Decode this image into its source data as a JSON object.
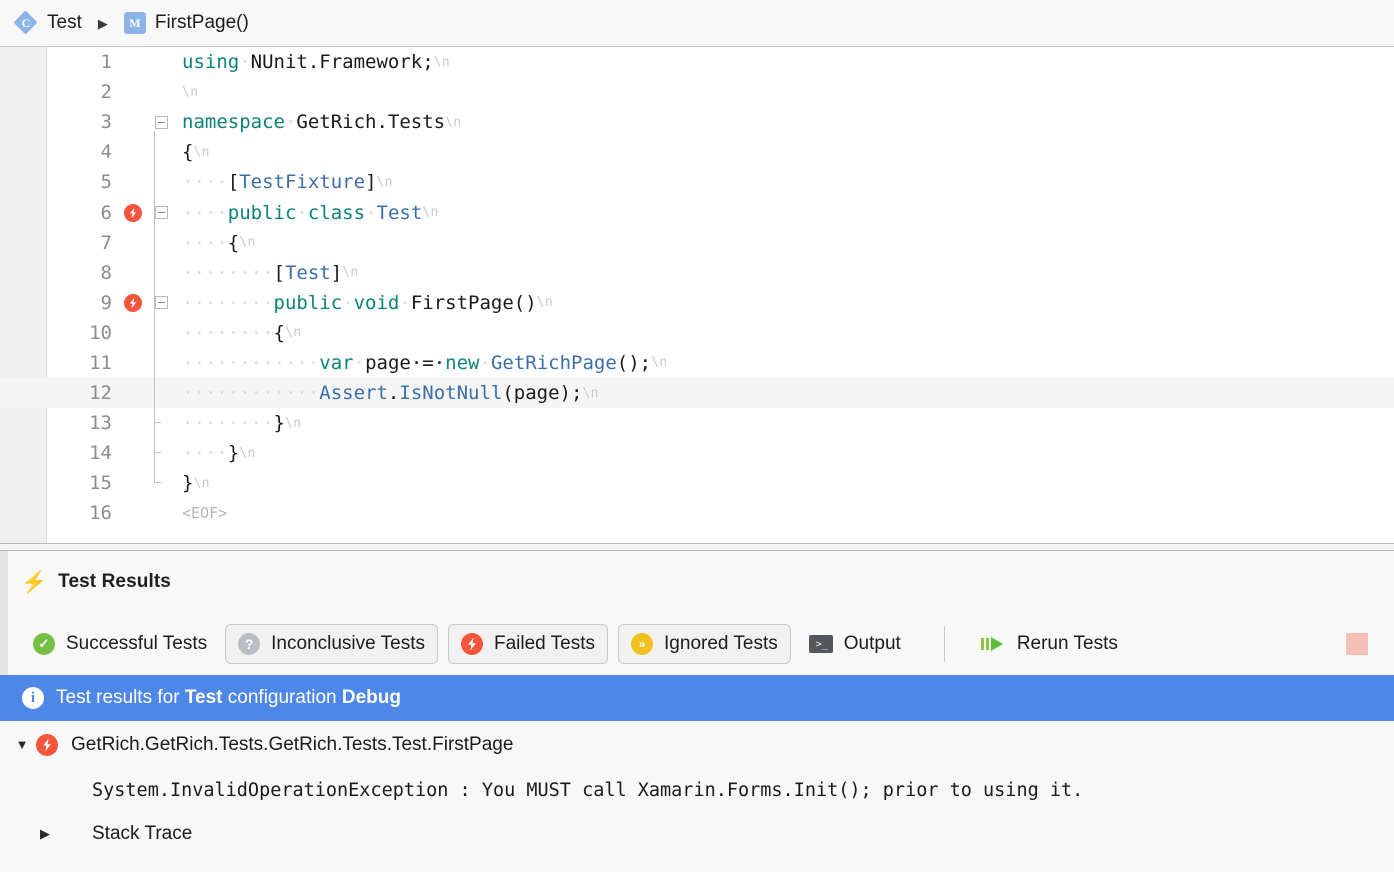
{
  "breadcrumb": {
    "class_icon": "class-icon",
    "class_name": "Test",
    "separator": "▶",
    "method_icon": "method-icon",
    "method_name": "FirstPage()"
  },
  "editor": {
    "eof_marker": "<EOF>",
    "newline_marker": "\\n",
    "lines": [
      {
        "num": "1",
        "fail": false,
        "fold": "none",
        "current": false,
        "tokens": [
          {
            "t": "using",
            "c": "kw"
          },
          {
            "t": "·",
            "c": "ws"
          },
          {
            "t": "NUnit.Framework;",
            "c": "pln"
          },
          {
            "t": "\\n",
            "c": "nl"
          }
        ]
      },
      {
        "num": "2",
        "fail": false,
        "fold": "none",
        "current": false,
        "tokens": [
          {
            "t": "\\n",
            "c": "nl"
          }
        ]
      },
      {
        "num": "3",
        "fail": false,
        "fold": "start",
        "current": false,
        "tokens": [
          {
            "t": "namespace",
            "c": "kw"
          },
          {
            "t": "·",
            "c": "ws"
          },
          {
            "t": "GetRich.Tests",
            "c": "pln"
          },
          {
            "t": "\\n",
            "c": "nl"
          }
        ]
      },
      {
        "num": "4",
        "fail": false,
        "fold": "body",
        "current": false,
        "tokens": [
          {
            "t": "{",
            "c": "pln"
          },
          {
            "t": "\\n",
            "c": "nl"
          }
        ]
      },
      {
        "num": "5",
        "fail": false,
        "fold": "body",
        "current": false,
        "tokens": [
          {
            "t": "····",
            "c": "ws"
          },
          {
            "t": "[",
            "c": "pln"
          },
          {
            "t": "TestFixture",
            "c": "typ"
          },
          {
            "t": "]",
            "c": "pln"
          },
          {
            "t": "\\n",
            "c": "nl"
          }
        ]
      },
      {
        "num": "6",
        "fail": true,
        "fold": "start",
        "current": false,
        "tokens": [
          {
            "t": "····",
            "c": "ws"
          },
          {
            "t": "public",
            "c": "kw"
          },
          {
            "t": "·",
            "c": "ws"
          },
          {
            "t": "class",
            "c": "kw"
          },
          {
            "t": "·",
            "c": "ws"
          },
          {
            "t": "Test",
            "c": "typ"
          },
          {
            "t": "\\n",
            "c": "nl"
          }
        ]
      },
      {
        "num": "7",
        "fail": false,
        "fold": "body",
        "current": false,
        "tokens": [
          {
            "t": "····",
            "c": "ws"
          },
          {
            "t": "{",
            "c": "pln"
          },
          {
            "t": "\\n",
            "c": "nl"
          }
        ]
      },
      {
        "num": "8",
        "fail": false,
        "fold": "body",
        "current": false,
        "tokens": [
          {
            "t": "········",
            "c": "ws"
          },
          {
            "t": "[",
            "c": "pln"
          },
          {
            "t": "Test",
            "c": "typ"
          },
          {
            "t": "]",
            "c": "pln"
          },
          {
            "t": "\\n",
            "c": "nl"
          }
        ]
      },
      {
        "num": "9",
        "fail": true,
        "fold": "start",
        "current": false,
        "tokens": [
          {
            "t": "········",
            "c": "ws"
          },
          {
            "t": "public",
            "c": "kw"
          },
          {
            "t": "·",
            "c": "ws"
          },
          {
            "t": "void",
            "c": "kw"
          },
          {
            "t": "·",
            "c": "ws"
          },
          {
            "t": "FirstPage()",
            "c": "pln"
          },
          {
            "t": "\\n",
            "c": "nl"
          }
        ]
      },
      {
        "num": "10",
        "fail": false,
        "fold": "body",
        "current": false,
        "tokens": [
          {
            "t": "········",
            "c": "ws"
          },
          {
            "t": "{",
            "c": "pln"
          },
          {
            "t": "\\n",
            "c": "nl"
          }
        ]
      },
      {
        "num": "11",
        "fail": false,
        "fold": "body",
        "current": false,
        "tokens": [
          {
            "t": "············",
            "c": "ws"
          },
          {
            "t": "var",
            "c": "kw"
          },
          {
            "t": "·",
            "c": "ws"
          },
          {
            "t": "page",
            "c": "pln"
          },
          {
            "t": "·=·",
            "c": "pln"
          },
          {
            "t": "new",
            "c": "kw"
          },
          {
            "t": "·",
            "c": "ws"
          },
          {
            "t": "GetRichPage",
            "c": "typ"
          },
          {
            "t": "();",
            "c": "pln"
          },
          {
            "t": "\\n",
            "c": "nl"
          }
        ]
      },
      {
        "num": "12",
        "fail": false,
        "fold": "body",
        "current": true,
        "tokens": [
          {
            "t": "············",
            "c": "ws"
          },
          {
            "t": "Assert",
            "c": "typ"
          },
          {
            "t": ".",
            "c": "pln"
          },
          {
            "t": "IsNotNull",
            "c": "typ"
          },
          {
            "t": "(page);",
            "c": "pln"
          },
          {
            "t": "\\n",
            "c": "nl"
          }
        ]
      },
      {
        "num": "13",
        "fail": false,
        "fold": "end",
        "current": false,
        "tokens": [
          {
            "t": "········",
            "c": "ws"
          },
          {
            "t": "}",
            "c": "pln"
          },
          {
            "t": "\\n",
            "c": "nl"
          }
        ]
      },
      {
        "num": "14",
        "fail": false,
        "fold": "end",
        "current": false,
        "tokens": [
          {
            "t": "····",
            "c": "ws"
          },
          {
            "t": "}",
            "c": "pln"
          },
          {
            "t": "\\n",
            "c": "nl"
          }
        ]
      },
      {
        "num": "15",
        "fail": false,
        "fold": "endlast",
        "current": false,
        "tokens": [
          {
            "t": "}",
            "c": "pln"
          },
          {
            "t": "\\n",
            "c": "nl"
          }
        ]
      },
      {
        "num": "16",
        "fail": false,
        "fold": "none",
        "current": false,
        "tokens": [
          {
            "t": "<EOF>",
            "c": "eof"
          }
        ]
      }
    ]
  },
  "test_results": {
    "header_title": "Test Results",
    "header_icon": "lightning-bolt-icon",
    "toolbar": [
      {
        "id": "successful",
        "label": "Successful Tests",
        "icon": "success-check-icon",
        "framed": false
      },
      {
        "id": "inconclusive",
        "label": "Inconclusive Tests",
        "icon": "question-mark-icon",
        "framed": true
      },
      {
        "id": "failed",
        "label": "Failed Tests",
        "icon": "failure-bolt-icon",
        "framed": true
      },
      {
        "id": "ignored",
        "label": "Ignored Tests",
        "icon": "ignored-skip-icon",
        "framed": true
      },
      {
        "id": "output",
        "label": "Output",
        "icon": "terminal-icon",
        "framed": false
      }
    ],
    "rerun": {
      "label": "Rerun Tests",
      "icon": "rerun-play-icon"
    },
    "stop_button": {
      "icon": "stop-square-icon"
    },
    "banner": {
      "icon": "info-icon",
      "prefix": "Test results for ",
      "configuration_name": "Test",
      "middle": " configuration ",
      "configuration": "Debug"
    },
    "tree": {
      "test_row": {
        "triangle": "▼",
        "icon": "failure-bolt-icon",
        "label": "GetRich.GetRich.Tests.GetRich.Tests.Test.FirstPage"
      },
      "message_row": {
        "text": "System.InvalidOperationException : You MUST call Xamarin.Forms.Init(); prior to using it."
      },
      "stack_row": {
        "triangle": "▶",
        "label": "Stack Trace"
      }
    }
  },
  "colors": {
    "keyword": "#0b8477",
    "type": "#3b6ea8",
    "plain": "#1a1a1a",
    "fail_red": "#f3563c",
    "success_green": "#76c043",
    "ignored_yellow": "#f2c01e",
    "banner_blue": "#4d87e8",
    "breadcrumb_blue": "#8cb4e8",
    "stop_pink": "#f5c1b6"
  }
}
